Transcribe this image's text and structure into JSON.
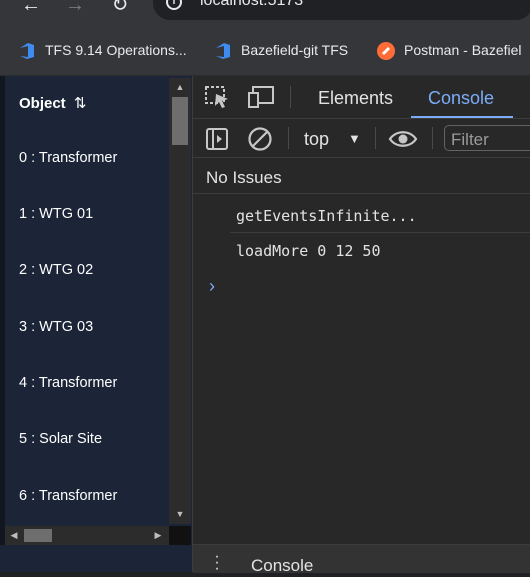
{
  "browser": {
    "url": "localhost:5173",
    "bookmarks": [
      {
        "label": "TFS 9.14 Operations...",
        "icon": "azure-devops-icon",
        "color": "#3f8cf0"
      },
      {
        "label": "Bazefield-git TFS",
        "icon": "azure-devops-icon",
        "color": "#3f8cf0"
      },
      {
        "label": "Postman - Bazefiel",
        "icon": "postman-icon",
        "color": "#ff6c37"
      }
    ]
  },
  "object_list": {
    "header": "Object",
    "sort_icon": "sort-arrows-icon",
    "items": [
      "0 : Transformer",
      "1 : WTG 01",
      "2 : WTG 02",
      "3 : WTG 03",
      "4 : Transformer",
      "5 : Solar Site",
      "6 : Transformer"
    ]
  },
  "devtools": {
    "tabs": {
      "elements": "Elements",
      "console": "Console"
    },
    "active_tab": "Console",
    "toolbar": {
      "context": "top",
      "filter_placeholder": "Filter"
    },
    "issues": "No Issues",
    "console_lines": [
      "getEventsInfinite...",
      "loadMore 0 12 50"
    ],
    "drawer_label": "Console",
    "accent_color": "#7cacf8"
  }
}
